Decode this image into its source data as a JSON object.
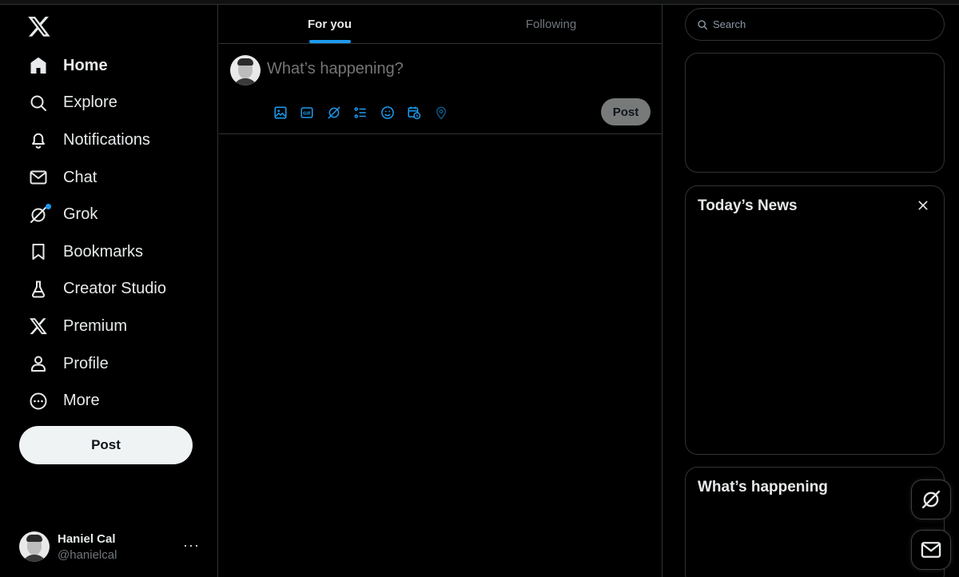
{
  "sidebar": {
    "items": [
      {
        "label": "Home",
        "icon": "home-icon"
      },
      {
        "label": "Explore",
        "icon": "search-icon"
      },
      {
        "label": "Notifications",
        "icon": "bell-icon"
      },
      {
        "label": "Chat",
        "icon": "envelope-icon"
      },
      {
        "label": "Grok",
        "icon": "grok-icon"
      },
      {
        "label": "Bookmarks",
        "icon": "bookmark-icon"
      },
      {
        "label": "Creator Studio",
        "icon": "flask-icon"
      },
      {
        "label": "Premium",
        "icon": "x-logo-icon"
      },
      {
        "label": "Profile",
        "icon": "person-icon"
      },
      {
        "label": "More",
        "icon": "more-circle-icon"
      }
    ],
    "post_label": "Post"
  },
  "account": {
    "name": "Haniel Cal",
    "handle": "@hanielcal",
    "more": "···"
  },
  "tabs": [
    {
      "label": "For you"
    },
    {
      "label": "Following"
    }
  ],
  "composer": {
    "placeholder": "What’s happening?",
    "post_label": "Post"
  },
  "search": {
    "placeholder": "Search"
  },
  "cards": {
    "news_title": "Today’s News",
    "happening_title": "What’s happening"
  },
  "colors": {
    "accent": "#1d9bf0",
    "background": "#000000",
    "border": "#2f3336"
  }
}
